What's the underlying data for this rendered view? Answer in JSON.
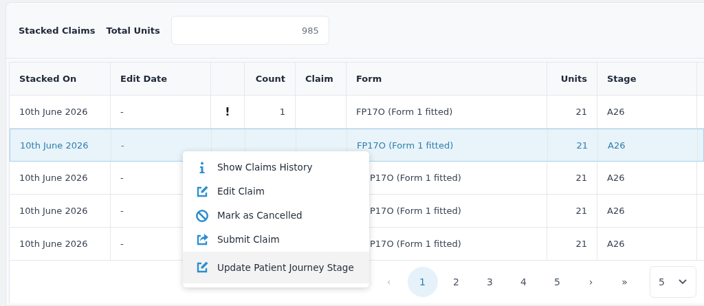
{
  "header": {
    "title": "Stacked Claims",
    "total_label": "Total Units",
    "total_value": "985"
  },
  "table": {
    "columns": [
      "Stacked On",
      "Edit Date",
      "",
      "Count",
      "Claim",
      "Form",
      "Units",
      "Stage"
    ],
    "rows": [
      {
        "selected": false,
        "cells": [
          "10th June 2026",
          "-",
          "!",
          "1",
          "",
          "FP17O (Form 1 fitted)",
          "21",
          "A26"
        ]
      },
      {
        "selected": true,
        "cells": [
          "10th June 2026",
          "-",
          "",
          "",
          "",
          "FP17O (Form 1 fitted)",
          "21",
          "A26"
        ]
      },
      {
        "selected": false,
        "cells": [
          "10th June 2026",
          "-",
          "",
          "",
          "",
          "P17O (Form 1 fitted)",
          "21",
          "A26"
        ]
      },
      {
        "selected": false,
        "cells": [
          "10th June 2026",
          "-",
          "",
          "",
          "",
          "P17O (Form 1 fitted)",
          "21",
          "A26"
        ]
      },
      {
        "selected": false,
        "cells": [
          "10th June 2026",
          "-",
          "",
          "",
          "",
          "P17O (Form 1 fitted)",
          "21",
          "A26"
        ]
      }
    ]
  },
  "context_menu": [
    {
      "kind": "info",
      "label": "Show Claims History",
      "selected": false
    },
    {
      "kind": "edit",
      "label": "Edit Claim",
      "selected": false
    },
    {
      "kind": "cancel",
      "label": "Mark as Cancelled",
      "selected": false
    },
    {
      "kind": "submit",
      "label": "Submit Claim",
      "selected": false
    },
    {
      "kind": "edit",
      "label": "Update Patient Journey Stage",
      "selected": true
    }
  ],
  "pagination": {
    "prev": {
      "label": "‹",
      "disabled": true
    },
    "pages": [
      {
        "label": "1",
        "selected": true
      },
      {
        "label": "2",
        "selected": false
      },
      {
        "label": "3",
        "selected": false
      },
      {
        "label": "4",
        "selected": false
      },
      {
        "label": "5",
        "selected": false
      }
    ],
    "next": "›",
    "last": "»",
    "page_size": "5"
  }
}
